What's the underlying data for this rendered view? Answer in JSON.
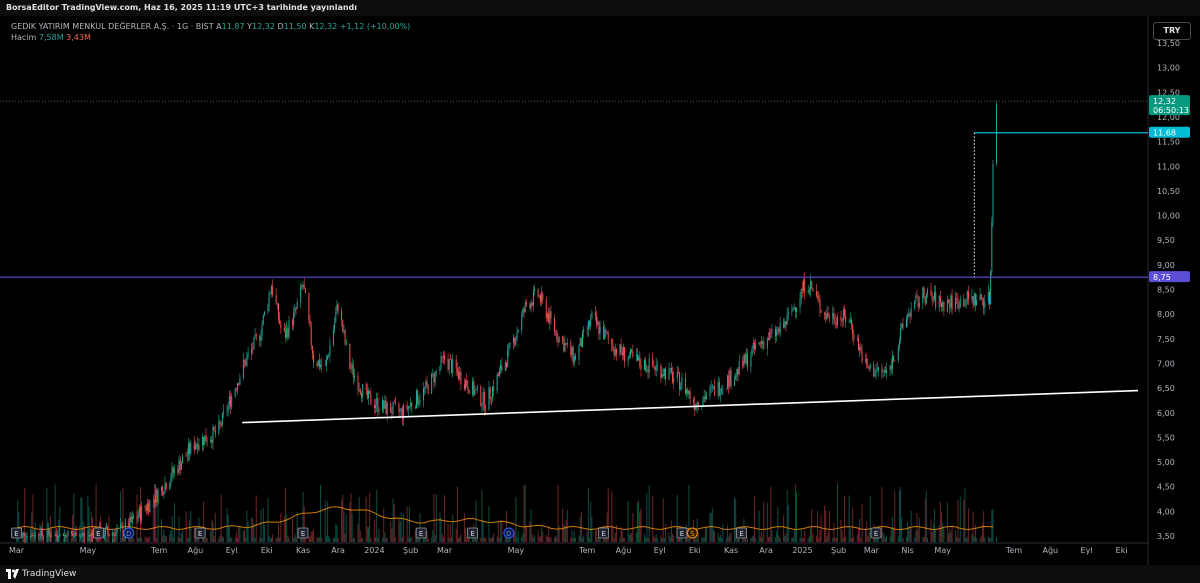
{
  "header": {
    "published": "BorsaEditor TradingView.com, Haz 16, 2025 11:19 UTC+3 tarihinde yayınlandı"
  },
  "legend": {
    "symbol": "GEDIK YATIRIM MENKUL DEĞERLER A.Ş. · 1G · BIST",
    "open_label": "A",
    "open": "11,87",
    "high_label": "Y",
    "high": "12,32",
    "low_label": "D",
    "low": "11,50",
    "close_label": "K",
    "close": "12,32",
    "change": "+1,12 (+10,00%)",
    "volume_label": "Hacim",
    "volume": "7,58M",
    "volume_ma": "3,43M"
  },
  "currency": "TRY",
  "footer": {
    "brand": "TradingView"
  },
  "colors": {
    "up": "#26a69a",
    "down": "#ef5350",
    "resistance": "#5b4fd6",
    "target": "#00bcd4",
    "trendline": "#ffffff",
    "last_price": "#089981",
    "volume_ma": "#ff9800"
  },
  "chart_data": {
    "type": "candlestick",
    "y_ticks": [
      "13,50",
      "13,00",
      "12,50",
      "12,00",
      "11,50",
      "11,00",
      "10,50",
      "10,00",
      "9,50",
      "9,00",
      "8,50",
      "8,00",
      "7,50",
      "7,00",
      "6,50",
      "6,00",
      "5,50",
      "5,00",
      "4,50",
      "4,00",
      "3,50"
    ],
    "ylim": [
      3.5,
      13.5
    ],
    "x_ticks": [
      {
        "label": "Mar",
        "date": "2023-03-01"
      },
      {
        "label": "May",
        "date": "2023-05-01"
      },
      {
        "label": "Tem",
        "date": "2023-07-01"
      },
      {
        "label": "Ağu",
        "date": "2023-08-01"
      },
      {
        "label": "Eyl",
        "date": "2023-09-01"
      },
      {
        "label": "Eki",
        "date": "2023-10-01"
      },
      {
        "label": "Kas",
        "date": "2023-11-01"
      },
      {
        "label": "Ara",
        "date": "2023-12-01"
      },
      {
        "label": "2024",
        "date": "2024-01-01"
      },
      {
        "label": "Şub",
        "date": "2024-02-01"
      },
      {
        "label": "Mar",
        "date": "2024-03-01"
      },
      {
        "label": "May",
        "date": "2024-05-01"
      },
      {
        "label": "Tem",
        "date": "2024-07-01"
      },
      {
        "label": "Ağu",
        "date": "2024-08-01"
      },
      {
        "label": "Eyl",
        "date": "2024-09-01"
      },
      {
        "label": "Eki",
        "date": "2024-10-01"
      },
      {
        "label": "Kas",
        "date": "2024-11-01"
      },
      {
        "label": "Ara",
        "date": "2024-12-01"
      },
      {
        "label": "2025",
        "date": "2025-01-01"
      },
      {
        "label": "Şub",
        "date": "2025-02-01"
      },
      {
        "label": "Mar",
        "date": "2025-03-01"
      },
      {
        "label": "Nis",
        "date": "2025-04-01"
      },
      {
        "label": "May",
        "date": "2025-05-01"
      },
      {
        "label": "Tem",
        "date": "2025-07-01"
      },
      {
        "label": "Ağu",
        "date": "2025-08-01"
      },
      {
        "label": "Eyl",
        "date": "2025-09-01"
      },
      {
        "label": "Eki",
        "date": "2025-10-01"
      }
    ],
    "price_path": [
      {
        "date": "2023-03-01",
        "close": 3.5
      },
      {
        "date": "2023-05-01",
        "close": 3.5
      },
      {
        "date": "2023-06-01",
        "close": 3.6
      },
      {
        "date": "2023-07-01",
        "close": 4.4
      },
      {
        "date": "2023-08-01",
        "close": 5.4
      },
      {
        "date": "2023-08-20",
        "close": 5.6
      },
      {
        "date": "2023-09-10",
        "close": 6.9
      },
      {
        "date": "2023-09-25",
        "close": 7.6
      },
      {
        "date": "2023-10-05",
        "close": 8.6
      },
      {
        "date": "2023-10-15",
        "close": 7.5
      },
      {
        "date": "2023-10-25",
        "close": 8.0
      },
      {
        "date": "2023-11-01",
        "close": 8.6
      },
      {
        "date": "2023-11-10",
        "close": 7.1
      },
      {
        "date": "2023-11-20",
        "close": 6.9
      },
      {
        "date": "2023-12-01",
        "close": 8.2
      },
      {
        "date": "2023-12-10",
        "close": 7.0
      },
      {
        "date": "2023-12-25",
        "close": 6.3
      },
      {
        "date": "2024-01-10",
        "close": 6.1
      },
      {
        "date": "2024-01-25",
        "close": 6.0
      },
      {
        "date": "2024-02-15",
        "close": 6.5
      },
      {
        "date": "2024-03-01",
        "close": 7.1
      },
      {
        "date": "2024-03-20",
        "close": 6.6
      },
      {
        "date": "2024-04-05",
        "close": 6.2
      },
      {
        "date": "2024-04-25",
        "close": 7.2
      },
      {
        "date": "2024-05-10",
        "close": 8.2
      },
      {
        "date": "2024-05-20",
        "close": 8.4
      },
      {
        "date": "2024-06-05",
        "close": 7.6
      },
      {
        "date": "2024-06-20",
        "close": 7.1
      },
      {
        "date": "2024-07-05",
        "close": 7.9
      },
      {
        "date": "2024-07-25",
        "close": 7.3
      },
      {
        "date": "2024-08-15",
        "close": 7.0
      },
      {
        "date": "2024-09-01",
        "close": 6.9
      },
      {
        "date": "2024-09-20",
        "close": 6.6
      },
      {
        "date": "2024-10-01",
        "close": 6.2
      },
      {
        "date": "2024-10-20",
        "close": 6.5
      },
      {
        "date": "2024-11-05",
        "close": 6.8
      },
      {
        "date": "2024-11-25",
        "close": 7.4
      },
      {
        "date": "2024-12-15",
        "close": 7.7
      },
      {
        "date": "2024-12-28",
        "close": 8.3
      },
      {
        "date": "2025-01-05",
        "close": 8.7
      },
      {
        "date": "2025-01-20",
        "close": 8.0
      },
      {
        "date": "2025-02-10",
        "close": 7.9
      },
      {
        "date": "2025-02-25",
        "close": 6.9
      },
      {
        "date": "2025-03-15",
        "close": 6.8
      },
      {
        "date": "2025-04-01",
        "close": 8.0
      },
      {
        "date": "2025-04-15",
        "close": 8.4
      },
      {
        "date": "2025-05-01",
        "close": 8.2
      },
      {
        "date": "2025-05-20",
        "close": 8.3
      },
      {
        "date": "2025-06-10",
        "close": 8.3
      },
      {
        "date": "2025-06-11",
        "close": 8.9
      },
      {
        "date": "2025-06-12",
        "close": 9.9
      },
      {
        "date": "2025-06-13",
        "close": 11.2
      },
      {
        "date": "2025-06-16",
        "close": 12.32
      }
    ],
    "annotations": {
      "resistance": {
        "label": "8,75",
        "value": 8.75
      },
      "target": {
        "label": "11,68",
        "value": 11.68
      },
      "last_price": {
        "label": "12,32",
        "value": 12.32,
        "countdown": "06:50:13"
      },
      "trendline": [
        {
          "date": "2023-09-10",
          "value": 5.8
        },
        {
          "date": "2025-10-15",
          "value": 6.45
        }
      ]
    },
    "events": [
      {
        "date": "2023-03-01",
        "type": "E"
      },
      {
        "date": "2023-05-10",
        "type": "E"
      },
      {
        "date": "2023-06-05",
        "type": "D"
      },
      {
        "date": "2023-08-05",
        "type": "E"
      },
      {
        "date": "2023-11-01",
        "type": "E"
      },
      {
        "date": "2024-02-10",
        "type": "E"
      },
      {
        "date": "2024-03-25",
        "type": "E"
      },
      {
        "date": "2024-04-25",
        "type": "D"
      },
      {
        "date": "2024-07-15",
        "type": "E"
      },
      {
        "date": "2024-09-20",
        "type": "E"
      },
      {
        "date": "2024-09-29",
        "type": "S"
      },
      {
        "date": "2024-11-10",
        "type": "E"
      },
      {
        "date": "2025-03-05",
        "type": "E"
      }
    ]
  }
}
